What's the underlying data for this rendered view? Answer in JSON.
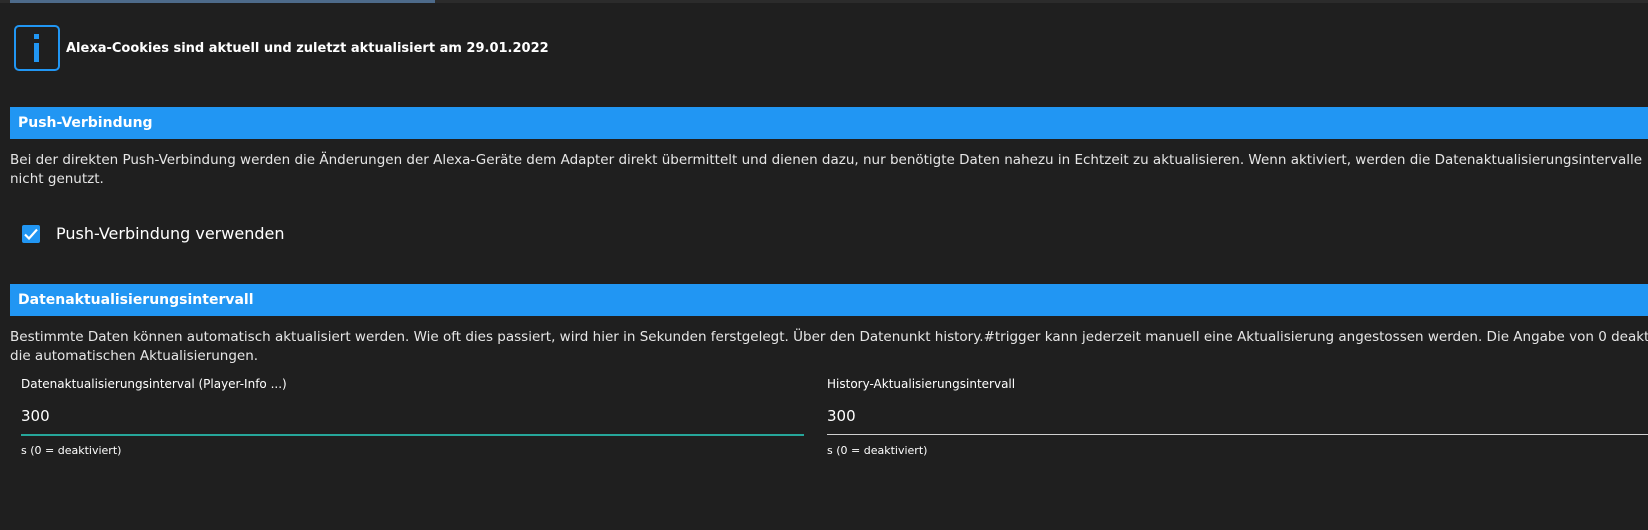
{
  "info": {
    "icon": "info-icon",
    "message": "Alexa-Cookies sind aktuell und zuletzt aktualisiert am 29.01.2022"
  },
  "push_section": {
    "title": "Push-Verbindung",
    "description_line1": "Bei der direkten Push-Verbindung werden die Änderungen der Alexa-Geräte dem Adapter direkt übermittelt und dienen dazu, nur benötigte Daten nahezu in Echtzeit zu aktualisieren. Wenn aktiviert, werden die Datenaktualisierungsintervalle",
    "description_line2": "nicht genutzt.",
    "checkbox": {
      "label": "Push-Verbindung verwenden",
      "checked": true
    }
  },
  "interval_section": {
    "title": "Datenaktualisierungsintervall",
    "description_line1": "Bestimmte Daten können automatisch aktualisiert werden. Wie oft dies passiert, wird hier in Sekunden ferstgelegt. Über den Datenunkt history.#trigger kann jederzeit manuell eine Aktualisierung angestossen werden. Die Angabe von 0 deakt",
    "description_line2": "die automatischen Aktualisierungen.",
    "fields": [
      {
        "label": "Datenaktualisierungsinterval (Player-Info ...)",
        "value": "300",
        "helper": "s (0 = deaktiviert)",
        "focused": true
      },
      {
        "label": "History-Aktualisierungsintervall",
        "value": "300",
        "helper": "s (0 = deaktiviert)",
        "focused": false
      }
    ]
  },
  "colors": {
    "background": "#1f1f1f",
    "accent": "#2196f3",
    "focus_underline": "#26a69a",
    "underline": "#cfcfcf"
  }
}
